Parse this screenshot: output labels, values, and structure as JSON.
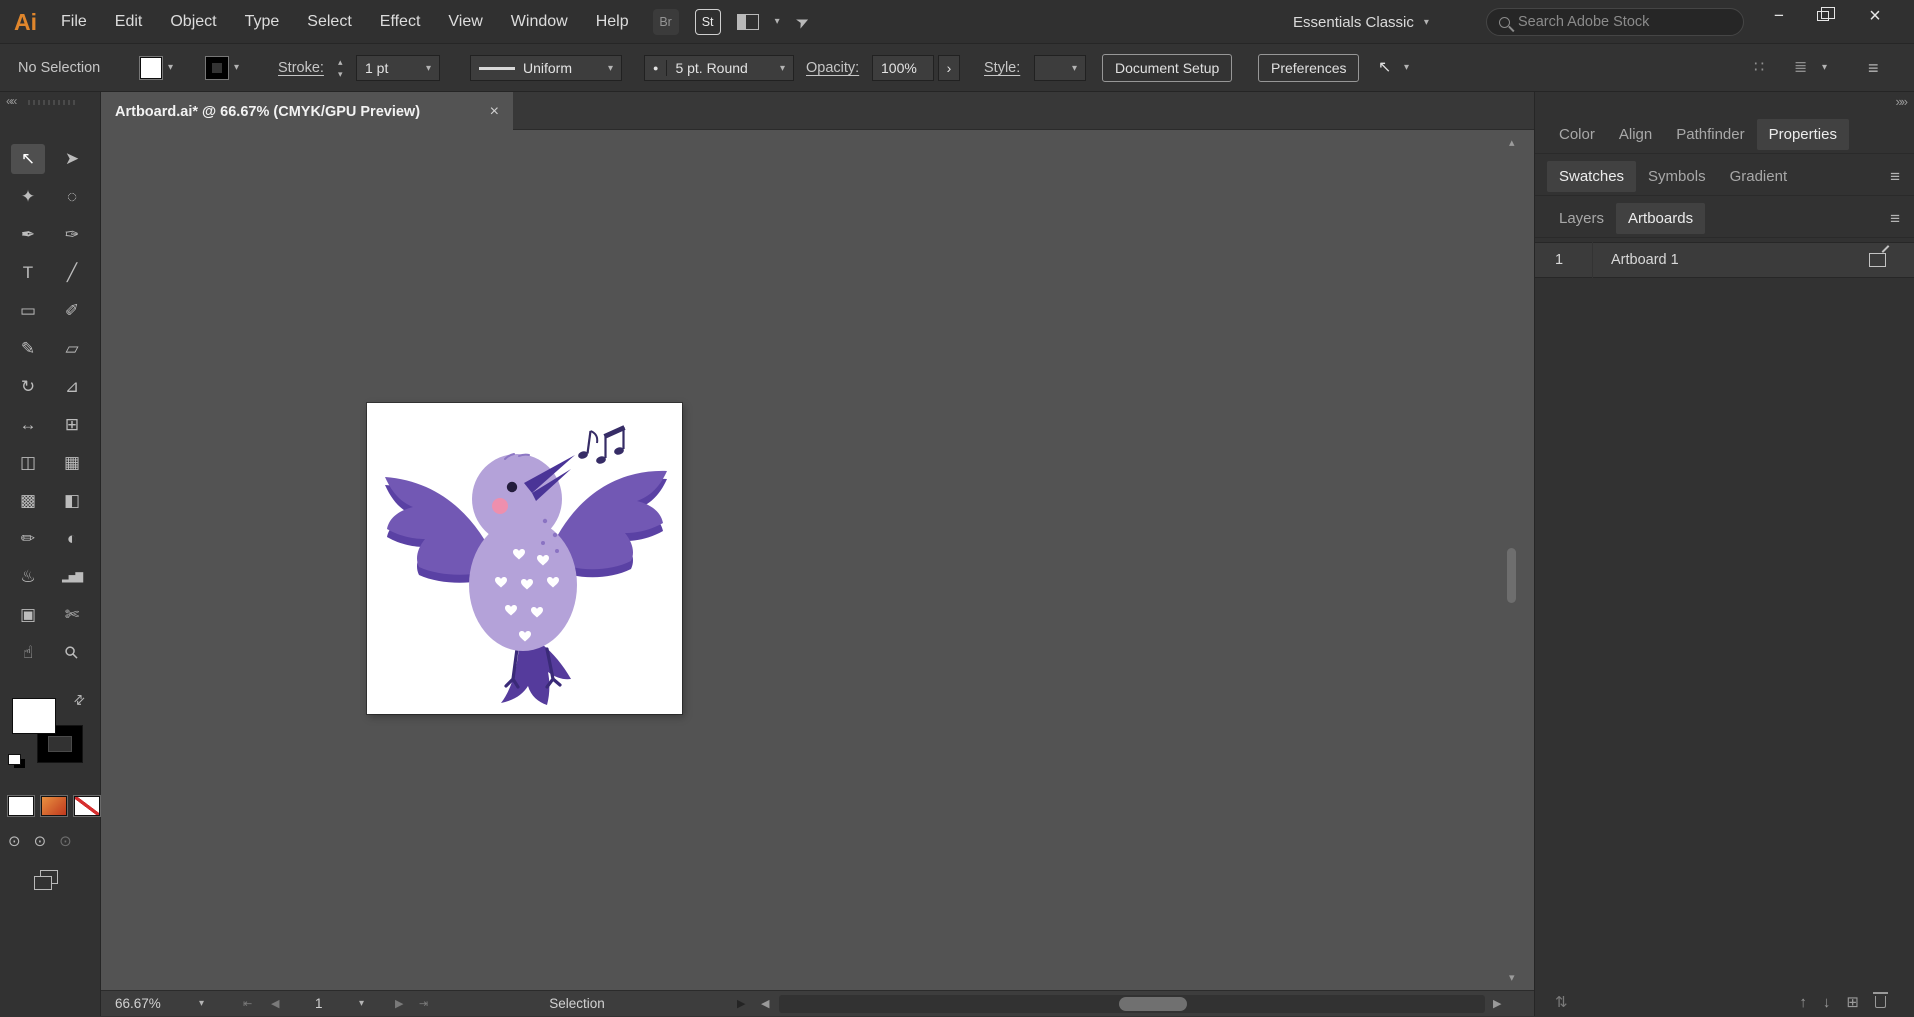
{
  "app": {
    "logo_text": "Ai",
    "workspace_name": "Essentials Classic"
  },
  "menubar": {
    "menus": [
      "File",
      "Edit",
      "Object",
      "Type",
      "Select",
      "Effect",
      "View",
      "Window",
      "Help"
    ],
    "bridge_icon_label": "Br",
    "stock_icon_label": "St",
    "search_placeholder": "Search Adobe Stock"
  },
  "control_bar": {
    "selection_status": "No Selection",
    "stroke_label": "Stroke:",
    "stroke_weight_value": "1 pt",
    "variable_width_value": "Uniform",
    "brush_value": "5 pt. Round",
    "opacity_label": "Opacity:",
    "opacity_value": "100%",
    "style_label": "Style:",
    "document_setup_button": "Document Setup",
    "preferences_button": "Preferences"
  },
  "document": {
    "tab_title": "Artboard.ai* @ 66.67% (CMYK/GPU Preview)",
    "close_glyph": "×"
  },
  "toolbar": {
    "tools": [
      {
        "name": "selection",
        "glyph": "↖"
      },
      {
        "name": "direct-selection",
        "glyph": "➤"
      },
      {
        "name": "magic-wand",
        "glyph": "✦"
      },
      {
        "name": "lasso",
        "glyph": "◌"
      },
      {
        "name": "pen",
        "glyph": "✒"
      },
      {
        "name": "curvature",
        "glyph": "✑"
      },
      {
        "name": "type",
        "glyph": "T"
      },
      {
        "name": "line-segment",
        "glyph": "╱"
      },
      {
        "name": "rectangle",
        "glyph": "▭"
      },
      {
        "name": "paintbrush",
        "glyph": "✐"
      },
      {
        "name": "shaper",
        "glyph": "✎"
      },
      {
        "name": "eraser",
        "glyph": "▱"
      },
      {
        "name": "rotate",
        "glyph": "↻"
      },
      {
        "name": "scale",
        "glyph": "⊿"
      },
      {
        "name": "width",
        "glyph": "↔"
      },
      {
        "name": "free-transform",
        "glyph": "⊞"
      },
      {
        "name": "shape-builder",
        "glyph": "◫"
      },
      {
        "name": "perspective-grid",
        "glyph": "▦"
      },
      {
        "name": "mesh",
        "glyph": "▩"
      },
      {
        "name": "gradient",
        "glyph": "◧"
      },
      {
        "name": "eyedropper",
        "glyph": "✏"
      },
      {
        "name": "blend",
        "glyph": "◐"
      },
      {
        "name": "symbol-sprayer",
        "glyph": "♨"
      },
      {
        "name": "column-graph",
        "glyph": "▂▅▇"
      },
      {
        "name": "artboard",
        "glyph": "▣"
      },
      {
        "name": "slice",
        "glyph": "✄"
      },
      {
        "name": "hand",
        "glyph": "☝"
      },
      {
        "name": "zoom",
        "glyph": "⚲"
      }
    ]
  },
  "panels": {
    "group1_tabs": [
      "Color",
      "Align",
      "Pathfinder",
      "Properties"
    ],
    "group1_active": "Properties",
    "group2_tabs": [
      "Swatches",
      "Symbols",
      "Gradient"
    ],
    "group2_active": "Swatches",
    "group3_tabs": [
      "Layers",
      "Artboards"
    ],
    "group3_active": "Artboards",
    "artboards": [
      {
        "number": "1",
        "name": "Artboard 1"
      }
    ]
  },
  "status_bar": {
    "zoom_value": "66.67%",
    "artboard_number": "1",
    "status_text": "Selection"
  },
  "icons": {
    "caret": "▾",
    "stepper_up": "▴",
    "stepper_down": "▾",
    "hamburger": "≡",
    "collapse_left": "««",
    "expand_right": "»»",
    "swap": "⇄",
    "grid_dots": "∷",
    "view_options": "≣",
    "share": "➤",
    "tool_cursor": "↖",
    "minimize": "−",
    "close": "×",
    "flyout": "›",
    "brush_bullet": "●",
    "nav_first": "⇤",
    "nav_prev": "◀",
    "nav_next": "▶",
    "nav_last": "⇥",
    "popup_arrow": "▶",
    "scroll_left": "◀",
    "scroll_right": "▶",
    "scroll_up": "▴",
    "scroll_down": "▾",
    "draw_mode": "⊙",
    "move_artboard": "⇅",
    "up_arrow": "↑",
    "down_arrow": "↓",
    "new_artboard": "⊞"
  },
  "colors": {
    "canvas_bg": "#535353",
    "panel_bg": "#323232",
    "bird_body": "#b4a2d9",
    "bird_wing": "#7258b4",
    "bird_wing_dark": "#5a41a4",
    "bird_tail": "#553b9c",
    "bird_beak": "#4a3497",
    "bird_cheek": "#ee8fae",
    "note_color": "#362c66",
    "gradient_button": "#d4682a"
  }
}
